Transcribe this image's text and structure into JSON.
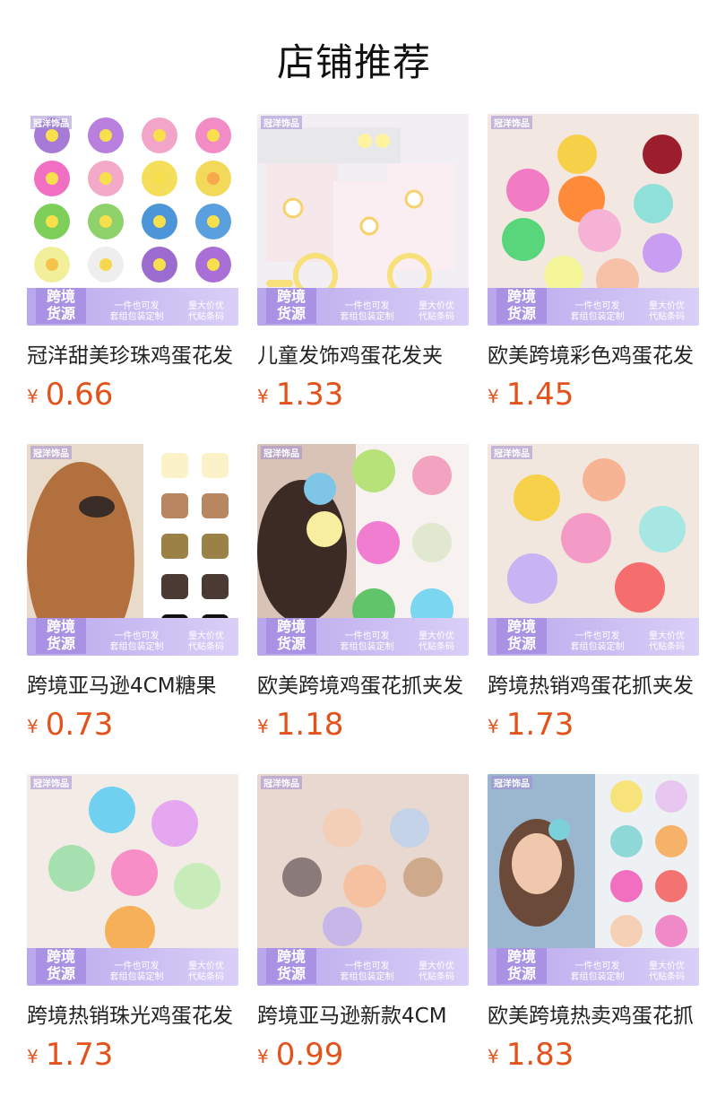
{
  "page_title": "店铺推荐",
  "colors": {
    "price": "#e2531c",
    "badge": "#a992e4"
  },
  "badge": {
    "shop": "冠洋饰品",
    "main_line1": "跨境",
    "main_line2": "货源",
    "mid_line1": "一件也可发",
    "mid_line2": "套组包装定制",
    "right_line1": "量大价优",
    "right_line2": "代贴条码"
  },
  "products": [
    {
      "name": "冠洋甜美珍珠鸡蛋花发",
      "currency": "¥",
      "price": "0.66"
    },
    {
      "name": "儿童发饰鸡蛋花发夹",
      "currency": "¥",
      "price": "1.33"
    },
    {
      "name": "欧美跨境彩色鸡蛋花发",
      "currency": "¥",
      "price": "1.45"
    },
    {
      "name": "跨境亚马逊4CM糖果",
      "currency": "¥",
      "price": "0.73"
    },
    {
      "name": "欧美跨境鸡蛋花抓夹发",
      "currency": "¥",
      "price": "1.18"
    },
    {
      "name": "跨境热销鸡蛋花抓夹发",
      "currency": "¥",
      "price": "1.73"
    },
    {
      "name": "跨境热销珠光鸡蛋花发",
      "currency": "¥",
      "price": "1.73"
    },
    {
      "name": "跨境亚马逊新款4CM",
      "currency": "¥",
      "price": "0.99"
    },
    {
      "name": "欧美跨境热卖鸡蛋花抓",
      "currency": "¥",
      "price": "1.83"
    }
  ]
}
